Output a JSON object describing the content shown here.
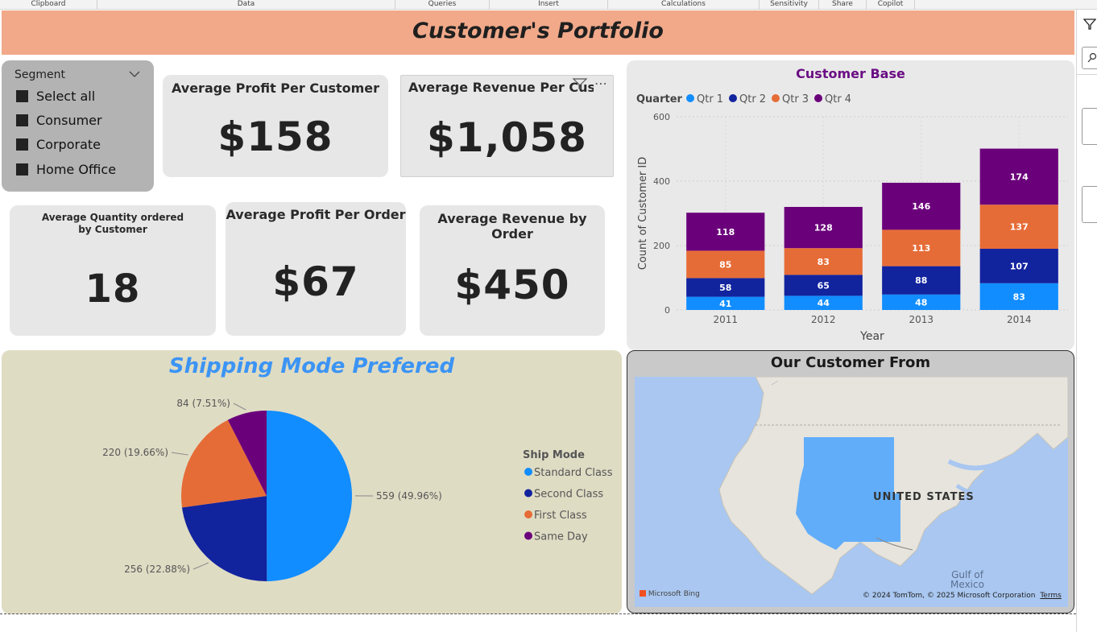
{
  "ribbon": [
    "Clipboard",
    "Data",
    "Queries",
    "Insert",
    "Calculations",
    "Sensitivity",
    "Share",
    "Copilot"
  ],
  "banner": {
    "title": "Customer's Portfolio"
  },
  "slicer": {
    "header": "Segment",
    "items": [
      "Select all",
      "Consumer",
      "Corporate",
      "Home Office"
    ]
  },
  "kpis": {
    "profit_per_customer": {
      "title": "Average Profit Per Customer",
      "value": "$158"
    },
    "revenue_per_customer": {
      "title": "Average Revenue Per Cust",
      "value": "$1,058"
    },
    "quantity_per_customer": {
      "title": "Average Quantity ordered by Customer",
      "value": "18"
    },
    "profit_per_order": {
      "title": "Average Profit Per Order",
      "value": "$67"
    },
    "revenue_by_order": {
      "title": "Average Revenue by Order",
      "value": "$450"
    }
  },
  "visual_icons": {
    "filter": "filter-icon",
    "more": "more-options-icon",
    "more_text": "⋯"
  },
  "customer_base": {
    "title": "Customer Base",
    "legend_title": "Quarter"
  },
  "shipping": {
    "title": "Shipping Mode Prefered",
    "legend_title": "Ship Mode"
  },
  "map": {
    "title": "Our Customer From",
    "label": "UNITED STATES",
    "gulf": "Gulf of Mexico",
    "bing": "Microsoft Bing",
    "copyright": "© 2024 TomTom, © 2025 Microsoft Corporation",
    "terms": "Terms"
  },
  "colors": {
    "qtr1": "#118dff",
    "qtr2": "#12239e",
    "qtr3": "#e66c37",
    "qtr4": "#6b007b",
    "banner": "#f1a98a",
    "ship_title": "#3c94f4",
    "cb_title": "#6b0d84"
  },
  "chart_data": [
    {
      "type": "bar",
      "stacked": true,
      "title": "Customer Base",
      "xlabel": "Year",
      "ylabel": "Count of Customer ID",
      "legend_title": "Quarter",
      "legend_position": "top-left",
      "categories": [
        "2011",
        "2012",
        "2013",
        "2014"
      ],
      "ylim": [
        0,
        600
      ],
      "yticks": [
        0,
        200,
        400,
        600
      ],
      "grid": true,
      "series": [
        {
          "name": "Qtr 1",
          "color": "#118dff",
          "values": [
            41,
            44,
            48,
            83
          ]
        },
        {
          "name": "Qtr 2",
          "color": "#12239e",
          "values": [
            58,
            65,
            88,
            107
          ]
        },
        {
          "name": "Qtr 3",
          "color": "#e66c37",
          "values": [
            85,
            83,
            113,
            137
          ]
        },
        {
          "name": "Qtr 4",
          "color": "#6b007b",
          "values": [
            118,
            128,
            146,
            174
          ]
        }
      ]
    },
    {
      "type": "pie",
      "title": "Shipping Mode Prefered",
      "legend_title": "Ship Mode",
      "legend_position": "right",
      "slices": [
        {
          "name": "Standard Class",
          "value": 559,
          "label": "559 (49.96%)",
          "color": "#118dff"
        },
        {
          "name": "Second Class",
          "value": 256,
          "label": "256 (22.88%)",
          "color": "#12239e"
        },
        {
          "name": "First Class",
          "value": 220,
          "label": "220 (19.66%)",
          "color": "#e66c37"
        },
        {
          "name": "Same Day",
          "value": 84,
          "label": "84 (7.51%)",
          "color": "#6b007b"
        }
      ]
    }
  ]
}
